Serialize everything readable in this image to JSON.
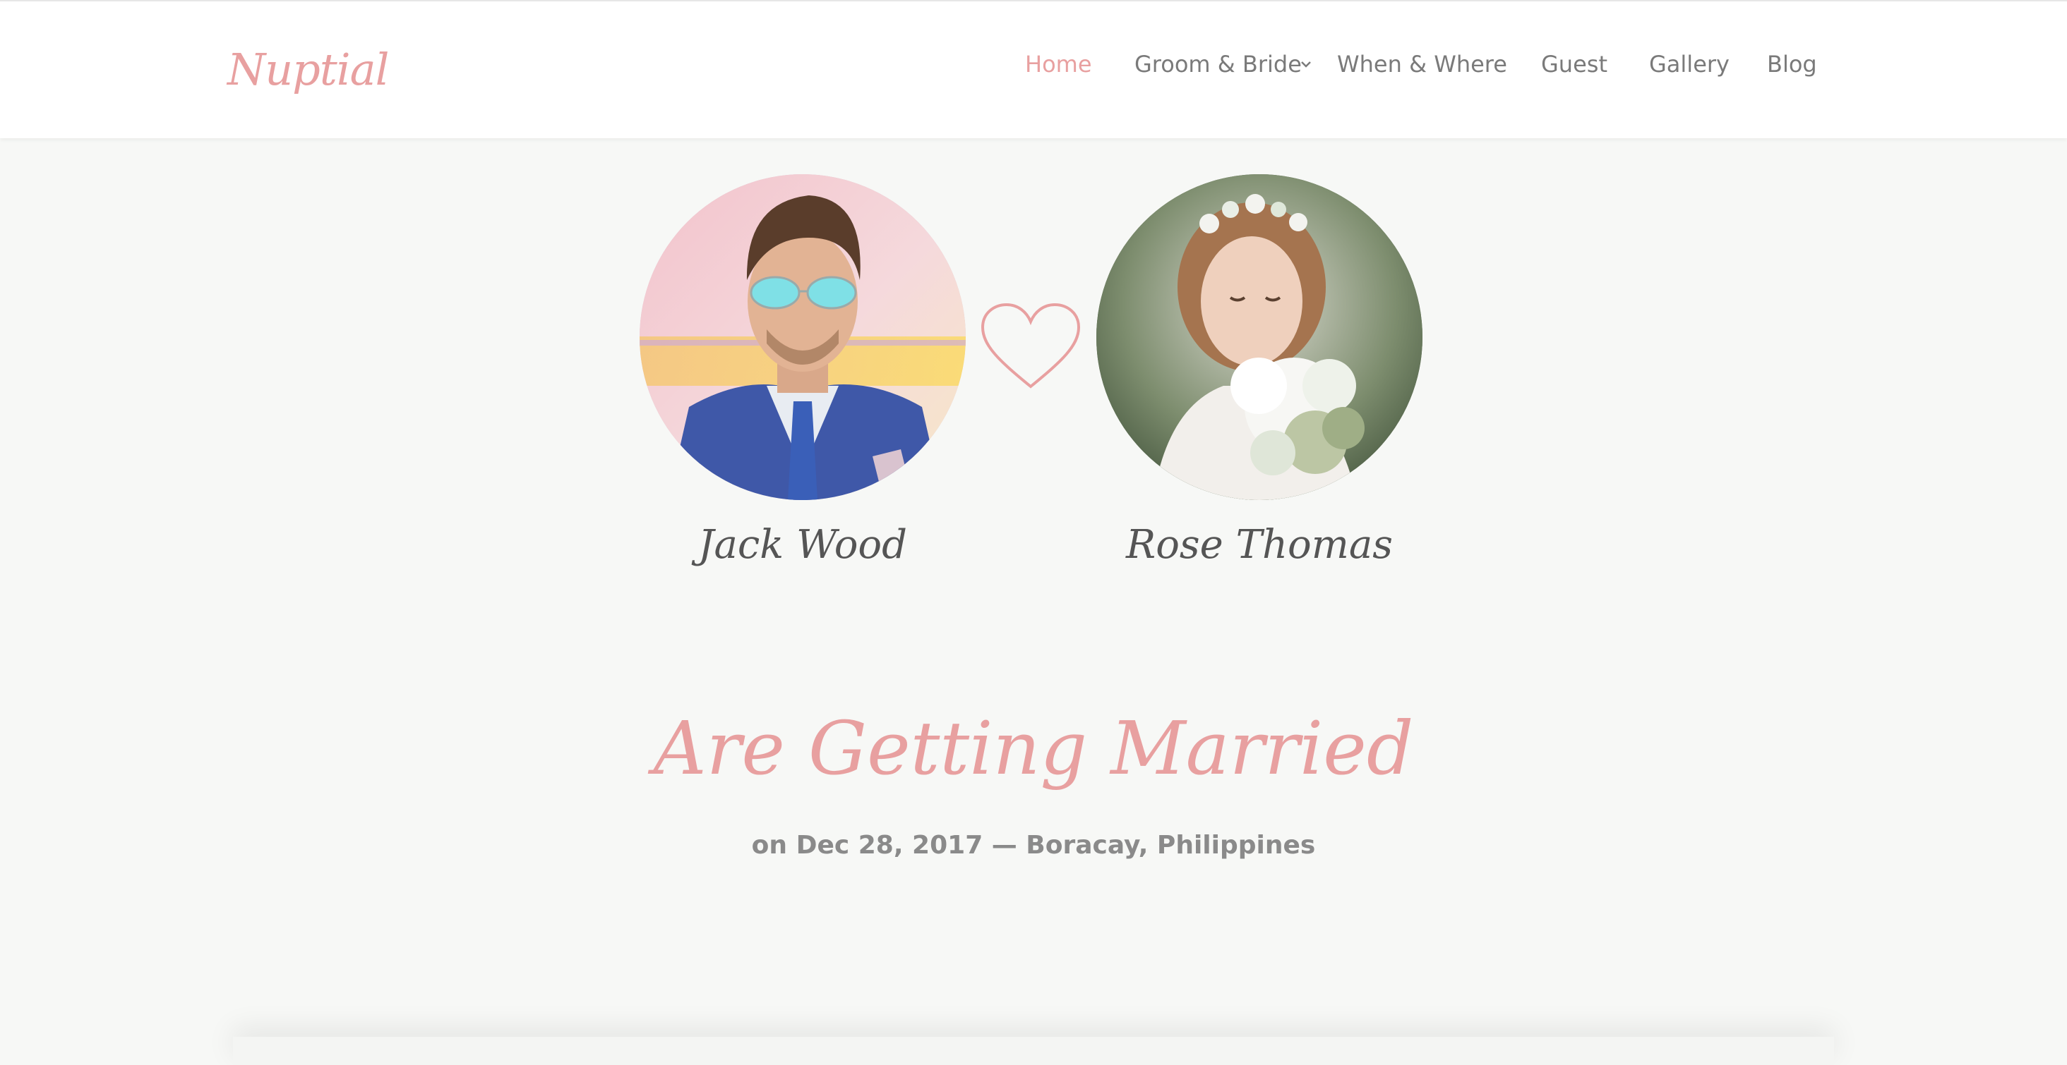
{
  "header": {
    "logo": "Nuptial",
    "nav": [
      {
        "label": "Home",
        "active": true
      },
      {
        "label": "Groom & Bride",
        "has_dropdown": true
      },
      {
        "label": "When & Where"
      },
      {
        "label": "Guest"
      },
      {
        "label": "Gallery"
      },
      {
        "label": "Blog"
      }
    ]
  },
  "couple": {
    "groom": {
      "name": "Jack Wood"
    },
    "bride": {
      "name": "Rose Thomas"
    }
  },
  "hero": {
    "title": "Are Getting Married",
    "subtitle": "on Dec 28, 2017 — Boracay, Philippines"
  },
  "colors": {
    "accent": "#e8a0a0",
    "background": "#f7f8f6",
    "text_gray": "#7a7a7a"
  },
  "icons": [
    "heart-icon",
    "chevron-down-icon"
  ]
}
